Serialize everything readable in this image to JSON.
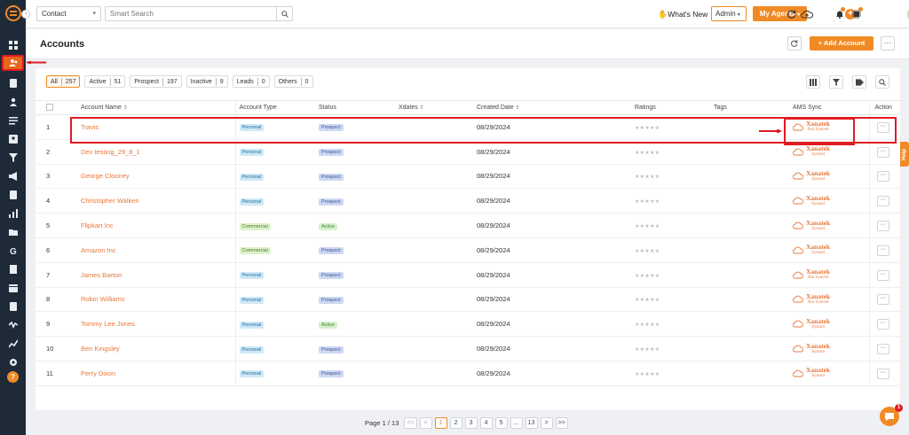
{
  "topbar": {
    "contact_selector": "Contact",
    "search_placeholder": "Smart Search",
    "whats_new": "What's New",
    "role_selector": "Admin",
    "my_agents": "My Agents"
  },
  "header": {
    "title": "Accounts",
    "add_button": "+  Add Account",
    "more": "···"
  },
  "filters": [
    {
      "label": "All",
      "count": "257",
      "active": true
    },
    {
      "label": "Active",
      "count": "51"
    },
    {
      "label": "Prospect",
      "count": "197"
    },
    {
      "label": "Inactive",
      "count": "9"
    },
    {
      "label": "Leads",
      "count": "0"
    },
    {
      "label": "Others",
      "count": "0"
    }
  ],
  "table": {
    "headers": {
      "account_name": "Account Name",
      "account_type": "Account Type",
      "status": "Status",
      "xdates": "Xdates",
      "created_date": "Created Date",
      "ratings": "Ratings",
      "tags": "Tags",
      "ams_sync": "AMS Sync",
      "action": "Action"
    },
    "rows": [
      {
        "n": "1",
        "name": "Travis",
        "type": "Personal",
        "status": "Prospect",
        "date": "08/29/2024",
        "ams_sub": "Not Synced"
      },
      {
        "n": "2",
        "name": "Dev testing_29_8_1",
        "type": "Personal",
        "status": "Prospect",
        "date": "08/29/2024",
        "ams_sub": "Synced"
      },
      {
        "n": "3",
        "name": "George Clooney",
        "type": "Personal",
        "status": "Prospect",
        "date": "08/29/2024",
        "ams_sub": "Synced"
      },
      {
        "n": "4",
        "name": "Christopher Walken",
        "type": "Personal",
        "status": "Prospect",
        "date": "08/29/2024",
        "ams_sub": "Synced"
      },
      {
        "n": "5",
        "name": "Flipkart Inc",
        "type": "Commercial",
        "status": "Active",
        "date": "08/29/2024",
        "ams_sub": "Synced"
      },
      {
        "n": "6",
        "name": "Amazon Inc",
        "type": "Commercial",
        "status": "Prospect",
        "date": "08/29/2024",
        "ams_sub": "Synced"
      },
      {
        "n": "7",
        "name": "James Barton",
        "type": "Personal",
        "status": "Prospect",
        "date": "08/29/2024",
        "ams_sub": "Not Synced"
      },
      {
        "n": "8",
        "name": "Robin Williams",
        "type": "Personal",
        "status": "Prospect",
        "date": "08/29/2024",
        "ams_sub": "Not Synced"
      },
      {
        "n": "9",
        "name": "Tommy Lee Jones",
        "type": "Personal",
        "status": "Active",
        "date": "08/29/2024",
        "ams_sub": "Synced"
      },
      {
        "n": "10",
        "name": "Ben Kingsley",
        "type": "Personal",
        "status": "Prospect",
        "date": "08/29/2024",
        "ams_sub": "Synced"
      },
      {
        "n": "11",
        "name": "Perry Dixon",
        "type": "Personal",
        "status": "Prospect",
        "date": "08/29/2024",
        "ams_sub": "Synced"
      }
    ],
    "ams_brand": "Xanatek",
    "ratings": "★★★★★",
    "action": "···"
  },
  "pagination": {
    "info": "Page 1 / 13",
    "first": "<<",
    "prev": "<",
    "pages": [
      "1",
      "2",
      "3",
      "4",
      "5",
      "...",
      "13"
    ],
    "next": ">",
    "last": ">>"
  },
  "help_tab": "Help",
  "chat_count": "1",
  "colors": {
    "accent": "#f08a24",
    "sidebar": "#1f2a38",
    "highlight": "#e01b22",
    "link": "#e8773a"
  }
}
